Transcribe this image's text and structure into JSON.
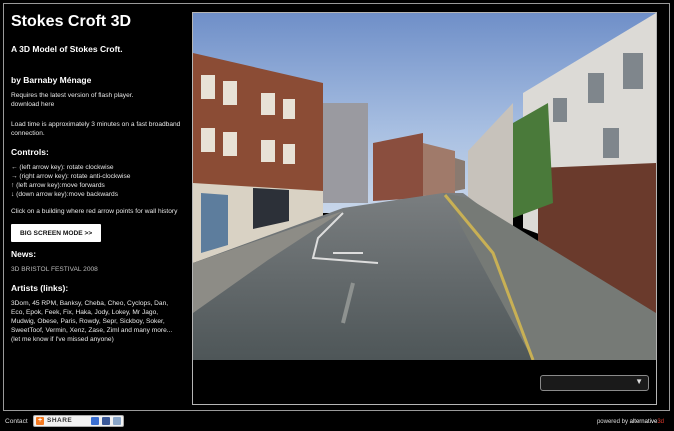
{
  "sidebar": {
    "title": "Stokes Croft 3D",
    "subtitle": "A 3D Model of Stokes Croft.",
    "author": "by Barnaby Ménage",
    "requirement": "Requires the latest version of flash player.",
    "download_label": "download here",
    "load_time": "Load time is approximately 3 minutes on a fast broadband connection.",
    "controls_heading": "Controls:",
    "controls": [
      "← (left arrow key): rotate clockwise",
      "→ (right arrow key): rotate anti-clockwise",
      "↑ (left arrow key):move forwards",
      "↓ (down arrow key):move backwards"
    ],
    "click_hint": "Click on a building where red arrow points for wall history",
    "big_screen_button": "BIG SCREEN MODE >>",
    "news_heading": "News:",
    "news_item": "3D BRISTOL FESTIVAL 2008",
    "artists_heading": "Artists (links):",
    "artists": "3Dom, 45 RPM, Banksy, Cheba, Cheo, Cyclops, Dan, Eco, Epok, Feek, Fix, Haka, Jody, Lokey, Mr Jago, Mudwig, Obese, Paris, Rowdy, Sepr, Sickboy, Soker, SweetToof, Vermin, Xenz, Zase, Ziml and many more... (let me know if I've missed anyone)"
  },
  "viewer": {
    "dropdown_value": "",
    "dropdown_icon": "chevron-down-icon"
  },
  "footer": {
    "contact": "Contact",
    "share_label": "SHARE",
    "powered_prefix": "powered by ",
    "powered_brand_a": "alternative",
    "powered_brand_b": "3d"
  },
  "colors": {
    "background": "#000000",
    "accent_red": "#e23b2e",
    "share_orange": "#f47920"
  }
}
